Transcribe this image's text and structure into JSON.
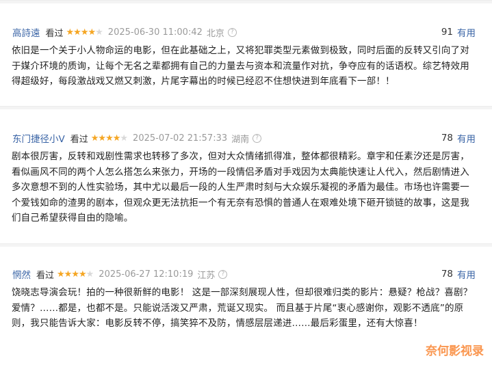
{
  "reviews": [
    {
      "user": "高詩遠",
      "status": "看过",
      "rating": 4,
      "date": "2025-06-30 11:00:42",
      "location": "北京",
      "votes": "91",
      "vote_label": "有用",
      "text": "依旧是一个关于小人物命运的电影，但在此基础之上，又将犯罪类型元素做到极致，同时后面的反转又引向了对于媒介环境的质询，让每个无名之辈都拥有自己的力量去与资本和流量作对抗，争夺应有的话语权。综艺特效用得超级好，每段激战戏又燃又刺激，片尾字幕出的时候已经忍不住想快进到年底看下一部！！"
    },
    {
      "user": "东门捷径小V",
      "status": "看过",
      "rating": 4,
      "date": "2025-07-02 21:57:33",
      "location": "湖南",
      "votes": "78",
      "vote_label": "有用",
      "text": "剧本很厉害，反转和戏剧性需求也转移了多次，但对大众情绪抓得准，整体都很精彩。章宇和任素汐还是厉害，看似画风不同的两个人怎么搭怎么来张力，开场的一段情侣矛盾对手戏因为太典能快速让人代入，然后剧情进入多次意想不到的人性实验场，其中尤以最后一段的人生严肃时刻与大众娱乐凝视的矛盾为最佳。市场也许需要一个爱钱如命的渣男的剧本，但观众更无法抗拒一个有无奈有恐惧的普通人在艰难处境下砸开锁链的故事，这是我们自己希望获得自由的隐喻。"
    },
    {
      "user": "惘然",
      "status": "看过",
      "rating": 4,
      "date": "2025-06-27 12:10:19",
      "location": "江苏",
      "votes": "78",
      "vote_label": "有用",
      "text": "饶晓志导演会玩！拍的一种很新鲜的电影！ 这是一部深刻展现人性，但却很难归类的影片：悬疑？枪战？喜剧？爱情？……都是，也都不是。只能说活泼又严肃，荒诞又现实。 而且基于片尾“衷心感谢你，观影不透底”的原则，我只能告诉大家：电影反转不停，搞笑猝不及防，情感层层递进……最后彩蛋里，还有大惊喜！"
    }
  ],
  "watermark": "奈何影视录",
  "icons": {
    "star": "star-icon",
    "info": "info-circle-icon"
  },
  "colors": {
    "username": "#3a64a6",
    "star": "#f5a623",
    "watermark": "#fa8b3c"
  }
}
